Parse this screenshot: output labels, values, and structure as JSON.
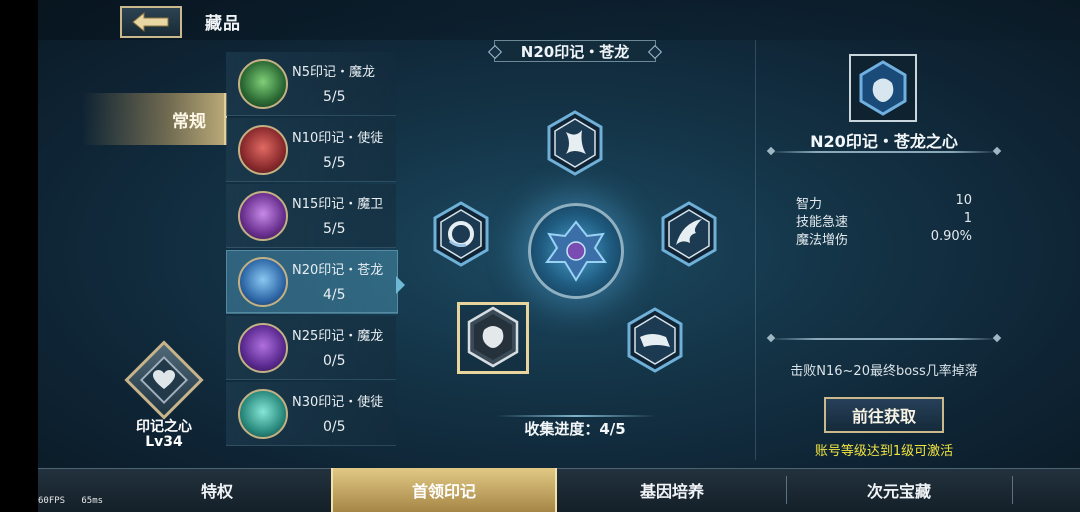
{
  "header": {
    "title": "藏品",
    "back_icon": "back-arrow-icon"
  },
  "category": {
    "label": "常规"
  },
  "core": {
    "name": "印记之心",
    "level": "Lv34",
    "icon": "heart-icon"
  },
  "seals": [
    {
      "name": "N5印记・魔龙",
      "progress": "5/5",
      "color": "#3e8a4a"
    },
    {
      "name": "N10印记・使徒",
      "progress": "5/5",
      "color": "#b0393c"
    },
    {
      "name": "N15印记・魔卫",
      "progress": "5/5",
      "color": "#8a4fb0"
    },
    {
      "name": "N20印记・苍龙",
      "progress": "4/5",
      "color": "#3d7cc4"
    },
    {
      "name": "N25印记・魔龙",
      "progress": "0/5",
      "color": "#7a3fb0"
    },
    {
      "name": "N30印记・使徒",
      "progress": "0/5",
      "color": "#3ea79a"
    }
  ],
  "center": {
    "title": "N20印记・苍龙",
    "collect_label": "收集进度：",
    "collect_value": "4/5",
    "collect_progress": 0.8
  },
  "detail": {
    "name": "N20印记・苍龙之心",
    "stats": [
      {
        "label": "智力",
        "value": "10"
      },
      {
        "label": "技能急速",
        "value": "1"
      },
      {
        "label": "魔法增伤",
        "value": "0.90%"
      }
    ],
    "drop": "击败N16~20最终boss几率掉落",
    "goto_label": "前往获取",
    "hint": "账号等级达到1级可激活"
  },
  "tabs": [
    {
      "label": "特权",
      "active": false
    },
    {
      "label": "首领印记",
      "active": true
    },
    {
      "label": "基因培养",
      "active": false
    },
    {
      "label": "次元宝藏",
      "active": false
    }
  ],
  "fps": {
    "fps_text": "60FPS",
    "ms_text": "65ms"
  },
  "colors": {
    "gold": "#c9b98c",
    "accent": "#6fb9d4",
    "hint": "#f0e341"
  }
}
